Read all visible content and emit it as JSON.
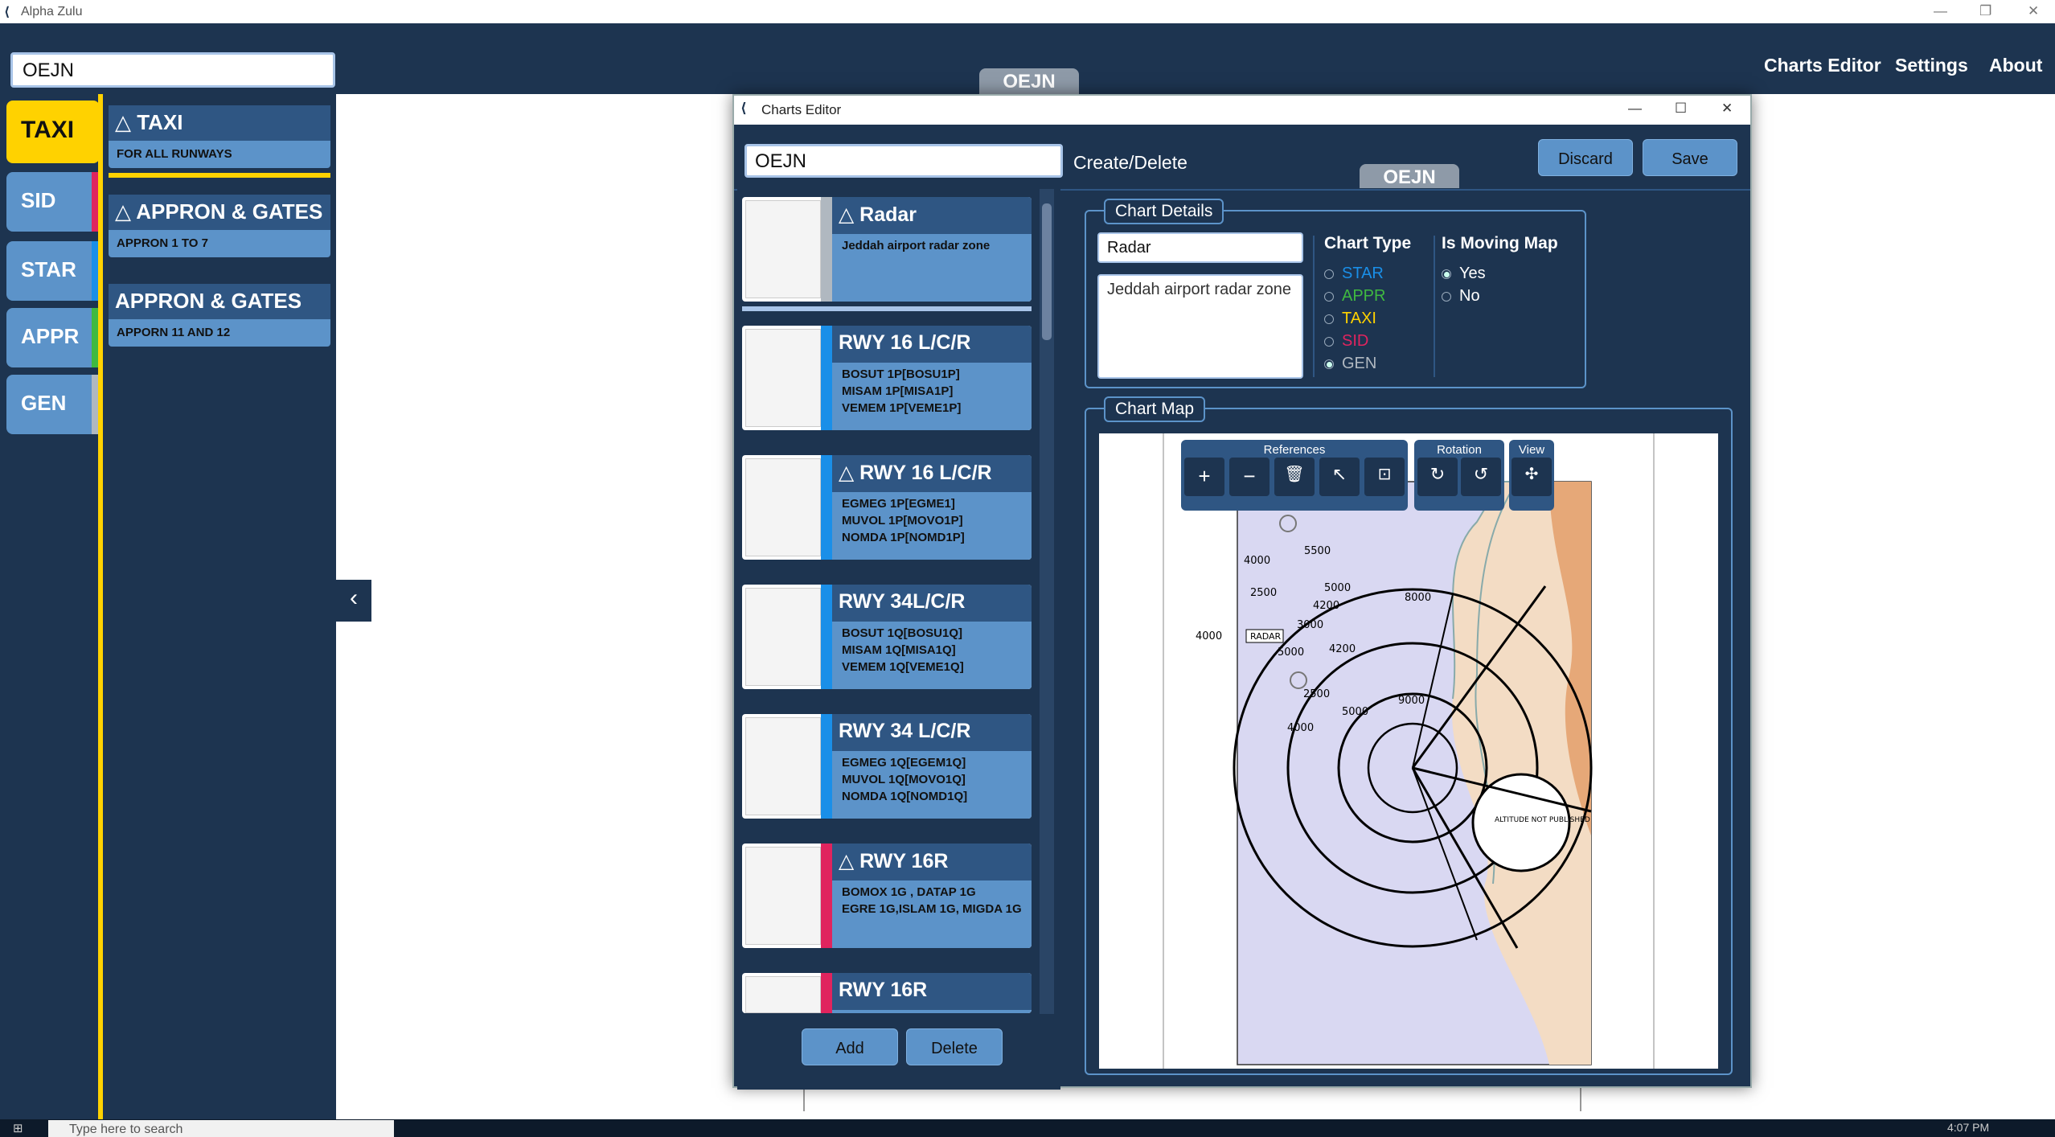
{
  "window": {
    "title": "Alpha Zulu"
  },
  "app": {
    "search_value": "OEJN",
    "nav": [
      "Charts Editor",
      "Settings",
      "About"
    ],
    "airport_tag": "OEJN"
  },
  "categories": [
    {
      "label": "TAXI",
      "color": "#ffd200"
    },
    {
      "label": "SID",
      "color": "#e0245e"
    },
    {
      "label": "STAR",
      "color": "#1a8fe8"
    },
    {
      "label": "APPR",
      "color": "#3fb940"
    },
    {
      "label": "GEN",
      "color": "#b0b8c0"
    }
  ],
  "side_charts": [
    {
      "title": "TAXI",
      "subtitle": "FOR ALL RUNWAYS",
      "moving": true
    },
    {
      "title": "APPRON & GATES",
      "subtitle": "APPRON 1 TO 7",
      "moving": true
    },
    {
      "title": "APPRON & GATES",
      "subtitle": "APPORN 11 AND 12",
      "moving": false
    }
  ],
  "collapse_icon": "chevron-left-icon",
  "editor": {
    "title": "Charts Editor",
    "code_value": "OEJN",
    "create_delete_label": "Create/Delete",
    "airport_tag": "OEJN",
    "discard_label": "Discard",
    "save_label": "Save",
    "add_label": "Add",
    "delete_label": "Delete",
    "list": [
      {
        "title": "Radar",
        "desc": "Jeddah airport  radar zone",
        "strip": "GEN",
        "strip_color": "#5c93c9",
        "moving": true
      },
      {
        "title": "RWY 16 L/C/R",
        "desc": "BOSUT 1P[BOSU1P]\nMISAM 1P[MISA1P]\nVEMEM 1P[VEME1P]",
        "strip": "STAR",
        "strip_color": "#1a8fe8",
        "moving": false
      },
      {
        "title": "RWY 16 L/C/R",
        "desc": "EGMEG 1P[EGME1]\nMUVOL 1P[MOVO1P]\nNOMDA 1P[NOMD1P]",
        "strip": "STAR",
        "strip_color": "#1a8fe8",
        "moving": true
      },
      {
        "title": "RWY 34L/C/R",
        "desc": "BOSUT 1Q[BOSU1Q]\nMISAM 1Q[MISA1Q]\nVEMEM 1Q[VEME1Q]",
        "strip": "STAR",
        "strip_color": "#1a8fe8",
        "moving": false
      },
      {
        "title": "RWY 34 L/C/R",
        "desc": "EGMEG 1Q[EGEM1Q]\nMUVOL 1Q[MOVO1Q]\nNOMDA 1Q[NOMD1Q]",
        "strip": "STAR",
        "strip_color": "#1a8fe8",
        "moving": false
      },
      {
        "title": "RWY 16R",
        "desc": "BOMOX 1G , DATAP 1G\nEGRE 1G,ISLAM 1G, MIGDA 1G",
        "strip": "SID",
        "strip_color": "#e0245e",
        "moving": true
      },
      {
        "title": "RWY 16R",
        "desc": "",
        "strip": "SID",
        "strip_color": "#e0245e",
        "moving": false
      }
    ],
    "details": {
      "legend": "Chart Details",
      "name_value": "Radar",
      "desc_value": "Jeddah airport  radar zone",
      "type_label": "Chart Type",
      "types": [
        {
          "label": "STAR",
          "color": "#1a8fe8",
          "checked": false
        },
        {
          "label": "APPR",
          "color": "#3fb940",
          "checked": false
        },
        {
          "label": "TAXI",
          "color": "#ffd200",
          "checked": false
        },
        {
          "label": "SID",
          "color": "#e0245e",
          "checked": false
        },
        {
          "label": "GEN",
          "color": "#b0b8c0",
          "checked": true
        }
      ],
      "moving_label": "Is Moving Map",
      "moving_options": [
        {
          "label": "Yes",
          "checked": true
        },
        {
          "label": "No",
          "checked": false
        }
      ]
    },
    "map": {
      "legend": "Chart Map",
      "toolbar": {
        "references_label": "References",
        "rotation_label": "Rotation",
        "view_label": "View",
        "tools": [
          "plus-icon",
          "minus-icon",
          "trash-icon",
          "arrow-up-left-icon",
          "crop-icon",
          "rotate-cw-icon",
          "rotate-ccw-icon",
          "move-icon"
        ]
      },
      "labels": {
        "radar": "RADAR",
        "altitude": "ALTITUDE\nNOT\nPUBLISHED",
        "sectors": [
          "5500",
          "4000",
          "2500",
          "5000",
          "4200",
          "3000",
          "8000",
          "4000",
          "5000",
          "4200",
          "2500",
          "5000",
          "9000",
          "4000"
        ]
      }
    }
  },
  "taskbar": {
    "search_placeholder": "Type here to search",
    "time": "4:07 PM"
  }
}
